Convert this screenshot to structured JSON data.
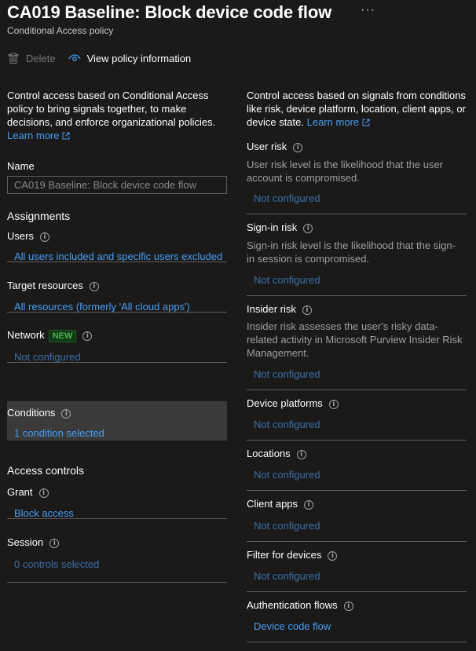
{
  "header": {
    "title": "CA019 Baseline: Block device code flow",
    "subtitle": "Conditional Access policy",
    "more_icon": "more-horizontal-icon"
  },
  "toolbar": {
    "delete_label": "Delete",
    "delete_icon": "trash-icon",
    "view_label": "View policy information",
    "view_icon": "eye-icon"
  },
  "left": {
    "intro": "Control access based on Conditional Access policy to bring signals together, to make decisions, and enforce organizational policies.",
    "learn_more": "Learn more",
    "name_label": "Name",
    "name_value": "CA019 Baseline: Block device code flow",
    "assignments_title": "Assignments",
    "assignments": [
      {
        "label": "Users",
        "value": "All users included and specific users excluded",
        "configured": true
      },
      {
        "label": "Target resources",
        "value": "All resources (formerly 'All cloud apps')",
        "configured": true
      },
      {
        "label": "Network",
        "badge": "NEW",
        "value": "Not configured",
        "configured": false
      },
      {
        "label": "Conditions",
        "value": "1 condition selected",
        "configured": true,
        "selected": true
      }
    ],
    "access_controls_title": "Access controls",
    "access_controls": [
      {
        "label": "Grant",
        "value": "Block access",
        "configured": true
      },
      {
        "label": "Session",
        "value": "0 controls selected",
        "configured": false
      }
    ]
  },
  "right": {
    "intro": "Control access based on signals from conditions like risk, device platform, location, client apps, or device state.",
    "learn_more": "Learn more",
    "conditions": [
      {
        "label": "User risk",
        "desc_lines": [
          "User risk level is the likelihood that the user",
          "account is compromised."
        ],
        "value": "Not configured",
        "configured": false
      },
      {
        "label": "Sign-in risk",
        "desc_lines": [
          "Sign-in risk level is the likelihood that the sign-",
          "in session is compromised."
        ],
        "value": "Not configured",
        "configured": false
      },
      {
        "label": "Insider risk",
        "desc_lines": [
          "Insider risk assesses the user's risky data-",
          "related activity in Microsoft Purview Insider Risk",
          "Management."
        ],
        "value": "Not configured",
        "configured": false
      },
      {
        "label": "Device platforms",
        "value": "Not configured",
        "configured": false
      },
      {
        "label": "Locations",
        "value": "Not configured",
        "configured": false
      },
      {
        "label": "Client apps",
        "value": "Not configured",
        "configured": false
      },
      {
        "label": "Filter for devices",
        "value": "Not configured",
        "configured": false
      },
      {
        "label": "Authentication flows",
        "value": "Device code flow",
        "configured": true
      }
    ]
  },
  "colors": {
    "background": "#1b1a19",
    "link": "#479ef5",
    "dim_link": "#3b6fa8",
    "muted": "#a19f9d",
    "divider": "#5f5e5c",
    "selected_bg": "#3b3a39",
    "badge_bg": "#0e3a16",
    "badge_fg": "#54b054"
  }
}
